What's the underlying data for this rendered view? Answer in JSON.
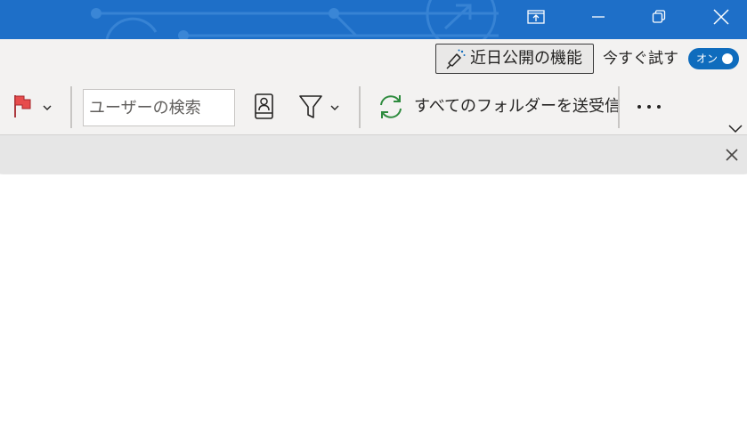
{
  "window_controls": {
    "pin_icon": "pin-to-top-icon",
    "minimize_icon": "minimize-icon",
    "restore_icon": "restore-icon",
    "close_icon": "close-icon"
  },
  "ribbon_top": {
    "coming_soon_label": "近日公開の機能",
    "coming_soon_icon": "megaphone-icon",
    "try_now_label": "今すぐ試す",
    "toggle_label": "オン"
  },
  "ribbon": {
    "flag_icon": "flag-icon",
    "search_placeholder": "ユーザーの検索",
    "address_book_icon": "address-book-icon",
    "filter_icon": "filter-icon",
    "sync_icon": "sync-icon",
    "send_receive_label": "すべてのフォルダーを送受信",
    "more_icon": "more-icon",
    "expand_icon": "chevron-down-icon"
  },
  "infobar": {
    "close_icon": "close-icon"
  },
  "colors": {
    "titlebar": "#1e6fc8",
    "ribbon_bg": "#f3f2f1",
    "accent_toggle": "#0f6cbd",
    "flag_red": "#e74c4c",
    "sync_green": "#2e8b3e"
  }
}
